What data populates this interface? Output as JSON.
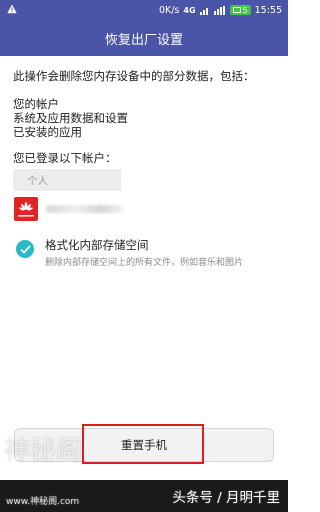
{
  "status_bar": {
    "speed": "0K/s",
    "network": "4G",
    "battery": "5",
    "time": "15:55",
    "bar_color": "#4a55a8"
  },
  "title": "恢复出厂设置",
  "intro": "此操作会删除您内存设备中的部分数据，包括：",
  "data_items": [
    "您的帐户",
    "系统及应用数据和设置",
    "已安装的应用"
  ],
  "accounts_label": "您已登录以下帐户：",
  "account_placeholder": "个人",
  "option": {
    "checked": true,
    "title": "格式化内部存储空间",
    "description": "删除内部存储空间上的所有文件，例如音乐和图片",
    "check_color": "#2db8c6"
  },
  "reset_button": "重置手机",
  "highlight_color": "#d81e1e",
  "watermark": {
    "right": "头条号 / 月明千里",
    "left": "神秘阁",
    "left_url": "www.神秘阁.com"
  }
}
